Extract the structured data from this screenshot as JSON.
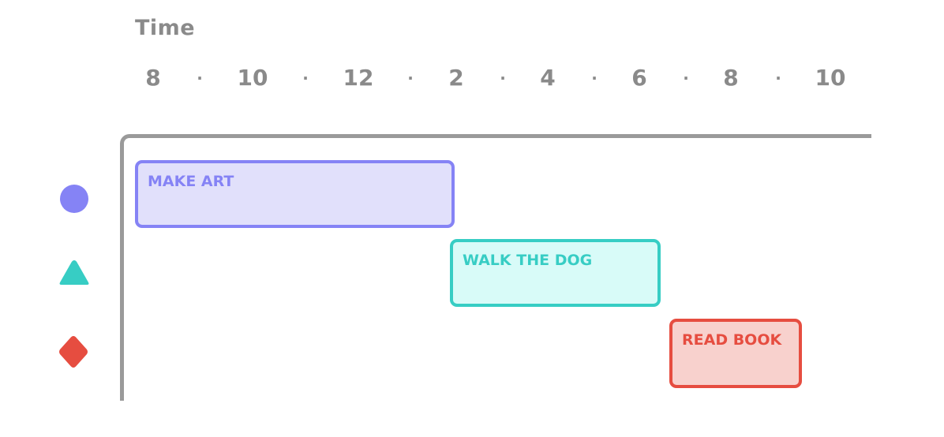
{
  "axis": {
    "title": "Time",
    "ticks": [
      "8",
      "·",
      "10",
      "·",
      "12",
      "·",
      "2",
      "·",
      "4",
      "·",
      "6",
      "·",
      "8",
      "·",
      "10"
    ]
  },
  "tasks": [
    {
      "label": "MAKE ART",
      "marker": "circle-icon",
      "color": "#8583f5",
      "fill": "#e1e0fb"
    },
    {
      "label": "WALK THE DOG",
      "marker": "triangle-icon",
      "color": "#37cdc4",
      "fill": "#d8fbf8"
    },
    {
      "label": "READ BOOK",
      "marker": "diamond-icon",
      "color": "#e64d40",
      "fill": "#f8d1cd"
    }
  ],
  "colors": {
    "axis": "#9a9a9a",
    "text": "#8a8a8a"
  }
}
